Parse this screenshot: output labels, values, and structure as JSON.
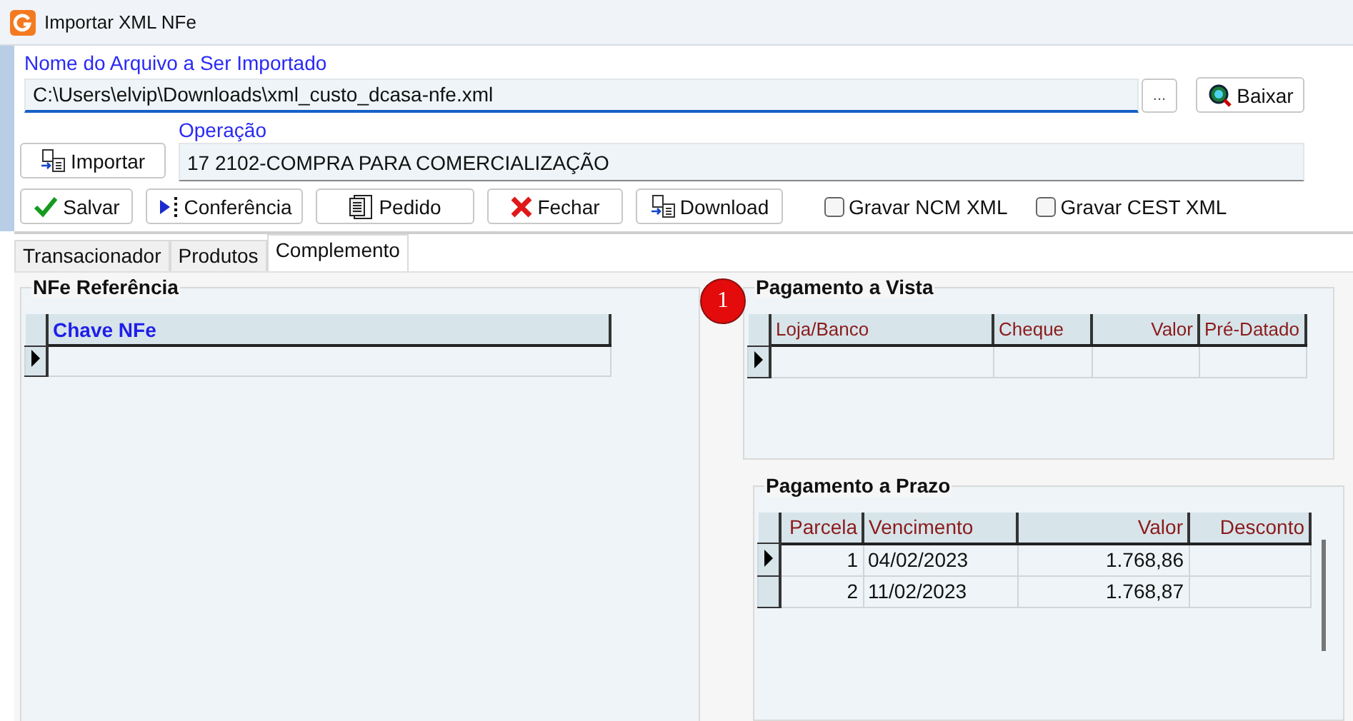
{
  "window": {
    "title": "Importar XML NFe"
  },
  "file": {
    "label": "Nome do Arquivo a Ser Importado",
    "value": "C:\\Users\\elvip\\Downloads\\xml_custo_dcasa-nfe.xml",
    "browse_button": "...",
    "download_button": "Baixar"
  },
  "import_button": "Importar",
  "operation": {
    "label": "Operação",
    "value": "17 2102-COMPRA PARA COMERCIALIZAÇÃO"
  },
  "toolbar": [
    "Salvar",
    "Conferência",
    "Pedido",
    "Fechar",
    "Download"
  ],
  "checkboxes": [
    {
      "label": "Gravar NCM XML",
      "checked": false
    },
    {
      "label": "Gravar CEST XML",
      "checked": false
    }
  ],
  "tabs": [
    {
      "label": "Transacionador",
      "selected": false
    },
    {
      "label": "Produtos",
      "selected": false
    },
    {
      "label": "Complemento",
      "selected": true
    }
  ],
  "nfe_referencia": {
    "title": "NFe Referência",
    "columns": [
      {
        "label": "Chave NFe",
        "numeric": false
      }
    ],
    "rows": [
      {
        "selected": true,
        "cells": []
      }
    ]
  },
  "badge": "1",
  "pagamento_vista": {
    "title": "Pagamento a Vista",
    "columns": [
      {
        "label": "Loja/Banco",
        "numeric": false
      },
      {
        "label": "Cheque",
        "numeric": false
      },
      {
        "label": "Valor",
        "numeric": true
      },
      {
        "label": "Pré-Datado",
        "numeric": false
      }
    ],
    "rows": [
      {
        "selected": true,
        "cells": []
      }
    ]
  },
  "pagamento_prazo": {
    "title": "Pagamento a Prazo",
    "columns": [
      {
        "label": "Parcela",
        "numeric": true
      },
      {
        "label": "Vencimento",
        "numeric": false
      },
      {
        "label": "Valor",
        "numeric": true
      },
      {
        "label": "Desconto",
        "numeric": true
      }
    ],
    "rows": [
      {
        "selected": true,
        "cells": [
          "1",
          "04/02/2023",
          "1.768,86"
        ]
      },
      {
        "selected": false,
        "cells": [
          "2",
          "11/02/2023",
          "1.768,87"
        ]
      }
    ]
  }
}
